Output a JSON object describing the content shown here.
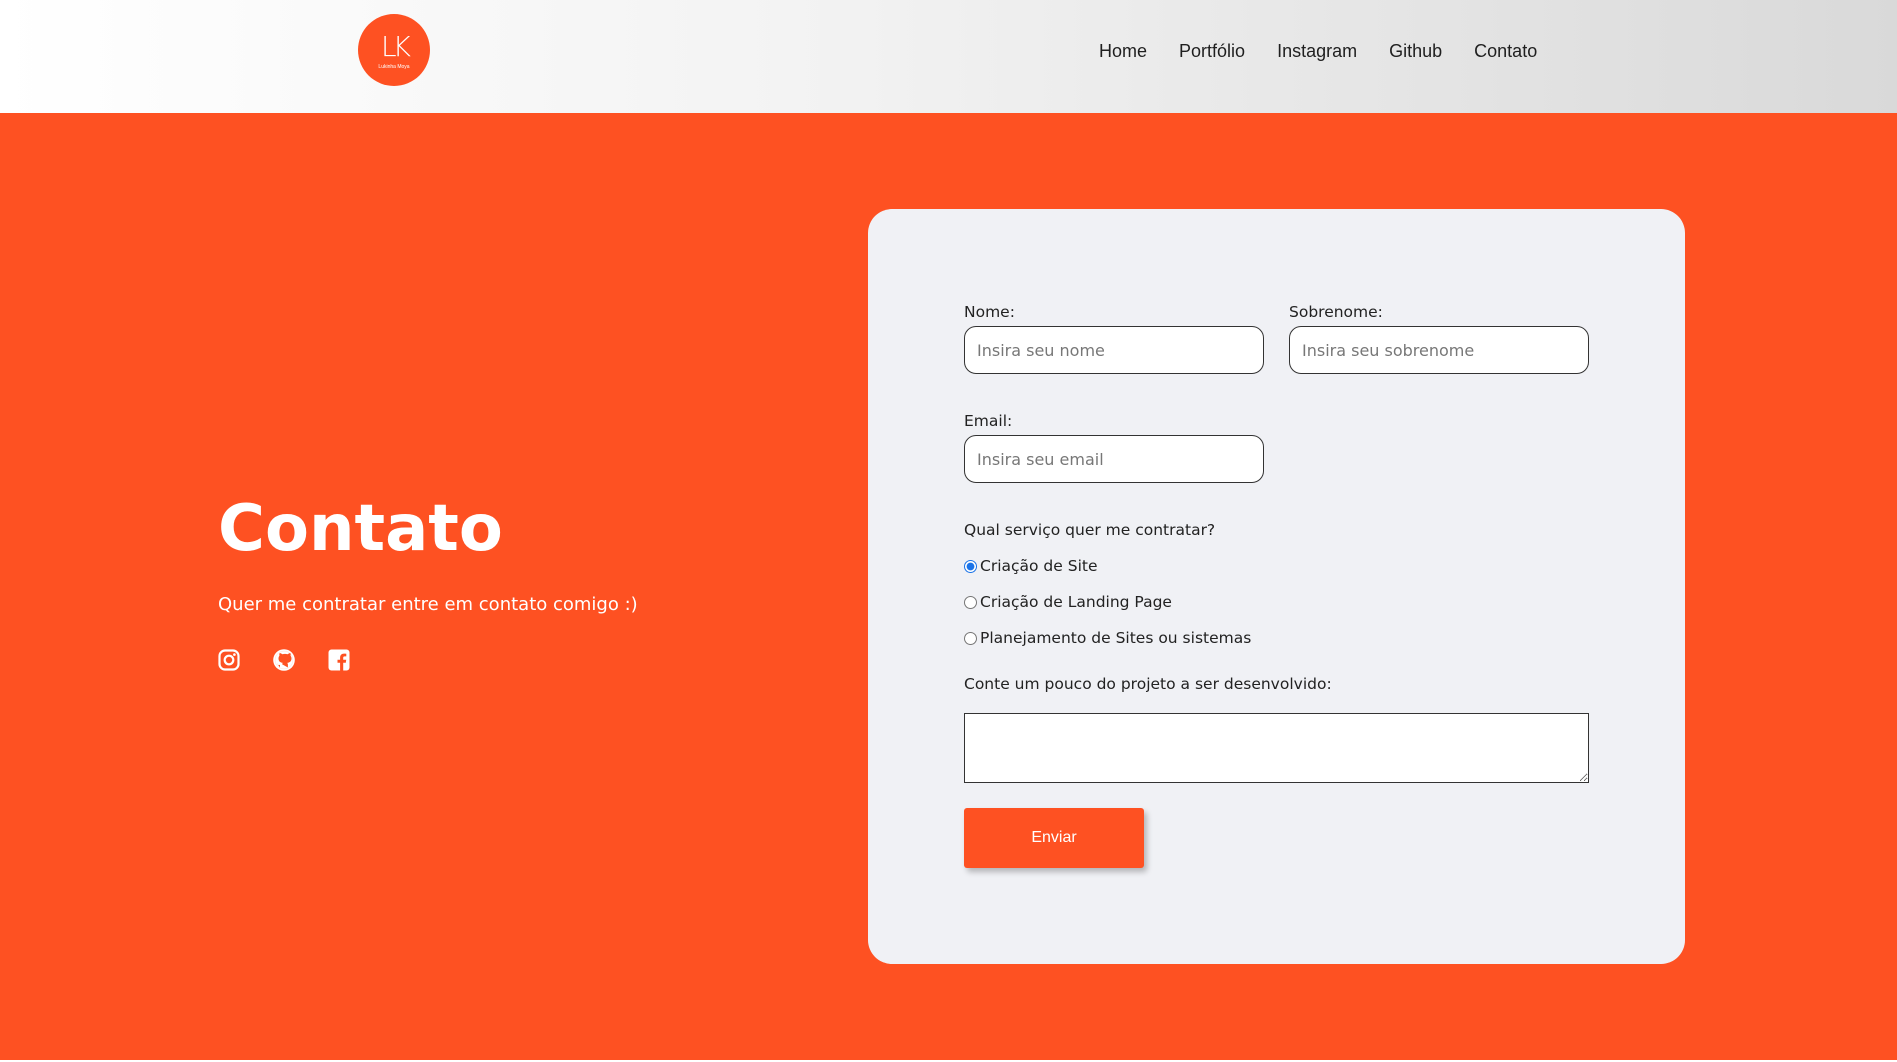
{
  "colors": {
    "accent": "#fe5122",
    "card_bg": "#f0f1f5",
    "text": "#222222"
  },
  "header": {
    "logo": {
      "mark": "LK",
      "text": "Lukinha Moya"
    },
    "nav": [
      "Home",
      "Portfólio",
      "Instagram",
      "Github",
      "Contato"
    ]
  },
  "hero": {
    "title": "Contato",
    "subtitle": "Quer me contratar entre em contato comigo :)",
    "social_icons": [
      "instagram-icon",
      "github-icon",
      "facebook-icon"
    ]
  },
  "form": {
    "first_name": {
      "label": "Nome:",
      "placeholder": "Insira seu nome",
      "value": ""
    },
    "last_name": {
      "label": "Sobrenome:",
      "placeholder": "Insira seu sobrenome",
      "value": ""
    },
    "email": {
      "label": "Email:",
      "placeholder": "Insira seu email",
      "value": ""
    },
    "service": {
      "question": "Qual serviço quer me contratar?",
      "options": [
        "Criação de Site",
        "Criação de Landing Page",
        "Planejamento de Sites ou sistemas"
      ],
      "selected": "Criação de Site"
    },
    "project": {
      "label": "Conte um pouco do projeto a ser desenvolvido:",
      "value": ""
    },
    "submit_label": "Enviar"
  }
}
